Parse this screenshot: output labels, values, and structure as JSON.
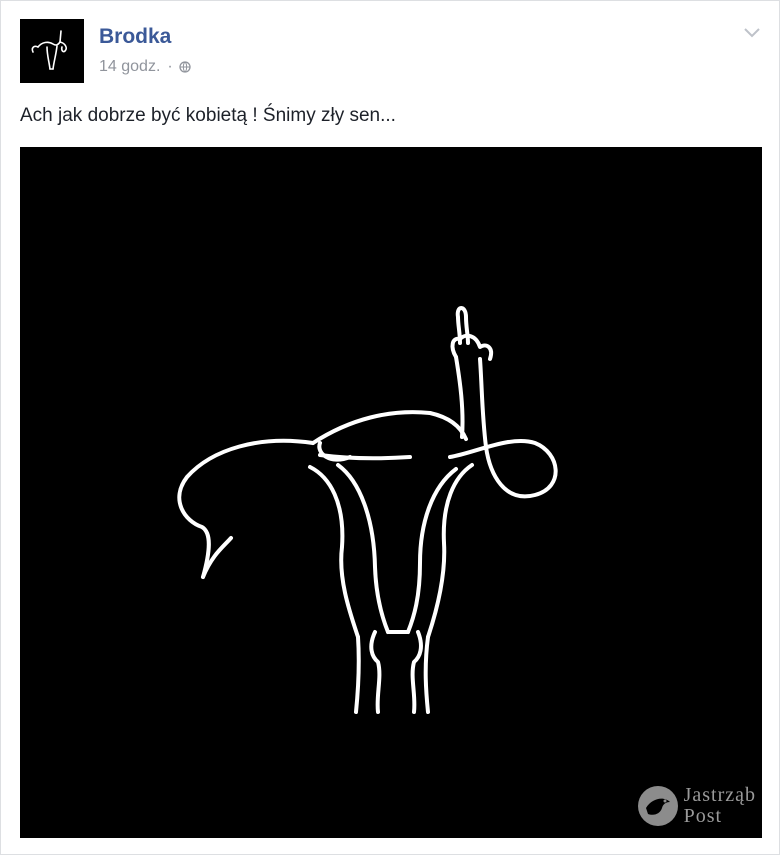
{
  "post": {
    "author": "Brodka",
    "timestamp": "14 godz.",
    "separator": "·",
    "audience_icon": "globe-icon",
    "options_icon": "chevron-down-icon",
    "text": "Ach jak dobrze być kobietą ! Śnimy zły sen..."
  },
  "photo": {
    "watermark_line1": "Jastrząb",
    "watermark_line2": "Post"
  },
  "colors": {
    "author_link": "#3b5998",
    "meta_text": "#90949c",
    "body_text": "#1d2129",
    "photo_background": "#000000",
    "illustration_stroke": "#ffffff"
  }
}
